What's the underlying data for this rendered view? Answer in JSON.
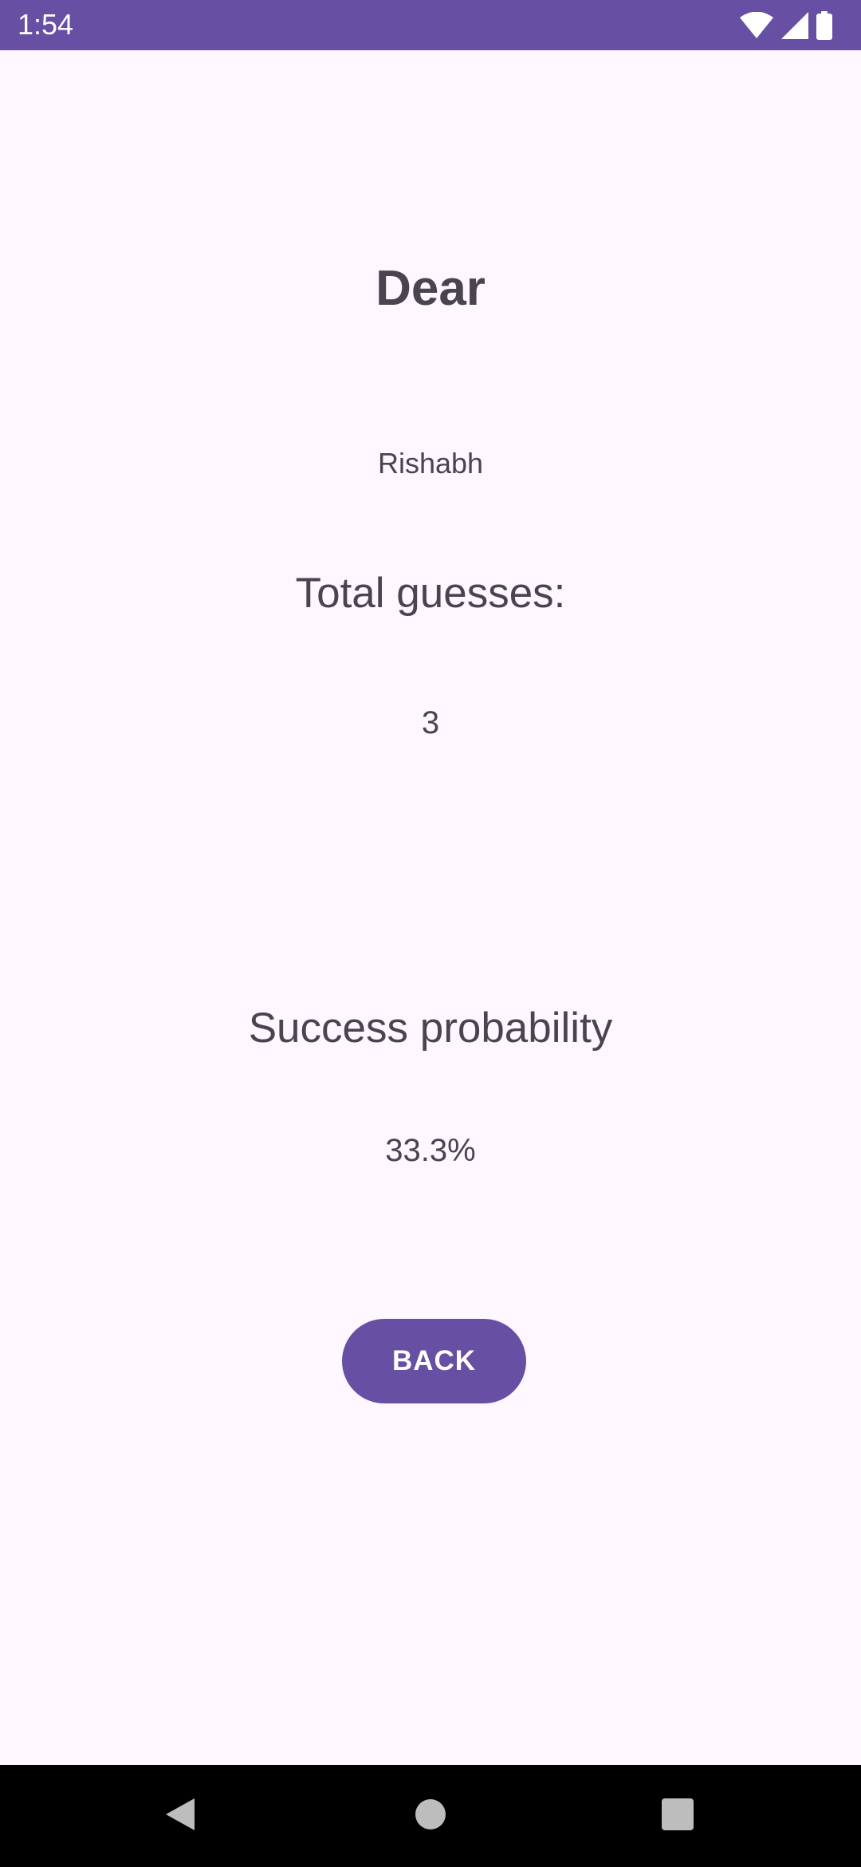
{
  "status_bar": {
    "time": "1:54",
    "background_color": "#6750A4",
    "icons": [
      "wifi-icon",
      "cell-signal-icon",
      "battery-icon"
    ]
  },
  "result": {
    "greeting": "Dear",
    "player_name": "Rishabh",
    "total_guesses_label": "Total guesses:",
    "total_guesses_value": "3",
    "success_probability_label": "Success probability",
    "success_probability_value": "33.3%"
  },
  "actions": {
    "back_label": "BACK",
    "accent_color": "#6750A4"
  },
  "nav_bar": {
    "icons": [
      "nav-back-icon",
      "nav-home-icon",
      "nav-recents-icon"
    ]
  },
  "colors": {
    "background": "#FEF7FF",
    "text": "#49454F"
  }
}
